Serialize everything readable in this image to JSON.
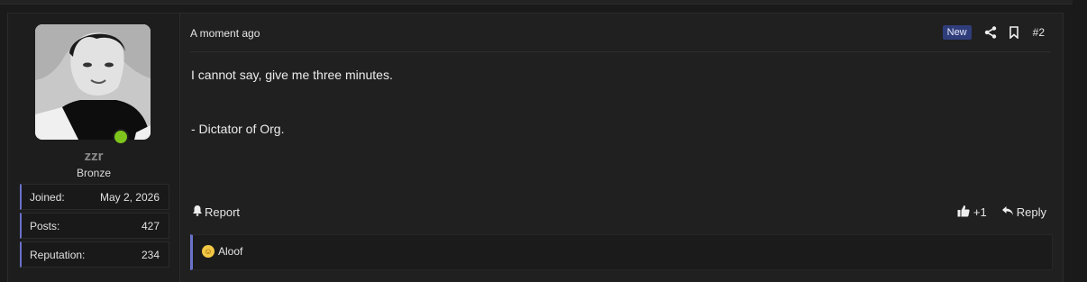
{
  "post": {
    "time": "A moment ago",
    "badge": "New",
    "number": "#2",
    "body": "I cannot say, give me three minutes.",
    "signature": "- Dictator of Org.",
    "report_label": "Report",
    "like_count": "+1",
    "reply_label": "Reply",
    "reaction_text": "Aloof"
  },
  "user": {
    "name": "zzr",
    "rank": "Bronze",
    "online": true,
    "stats": [
      {
        "label": "Joined:",
        "value": "May 2, 2026"
      },
      {
        "label": "Posts:",
        "value": "427"
      },
      {
        "label": "Reputation:",
        "value": "234"
      }
    ]
  },
  "colors": {
    "accent": "#6a72c9",
    "online": "#7ec41c",
    "badge_bg": "#2f3d7a"
  },
  "icons": [
    "share-icon",
    "bookmark-icon",
    "bell-icon",
    "thumbs-up-icon",
    "reply-icon",
    "emoji-icon"
  ]
}
